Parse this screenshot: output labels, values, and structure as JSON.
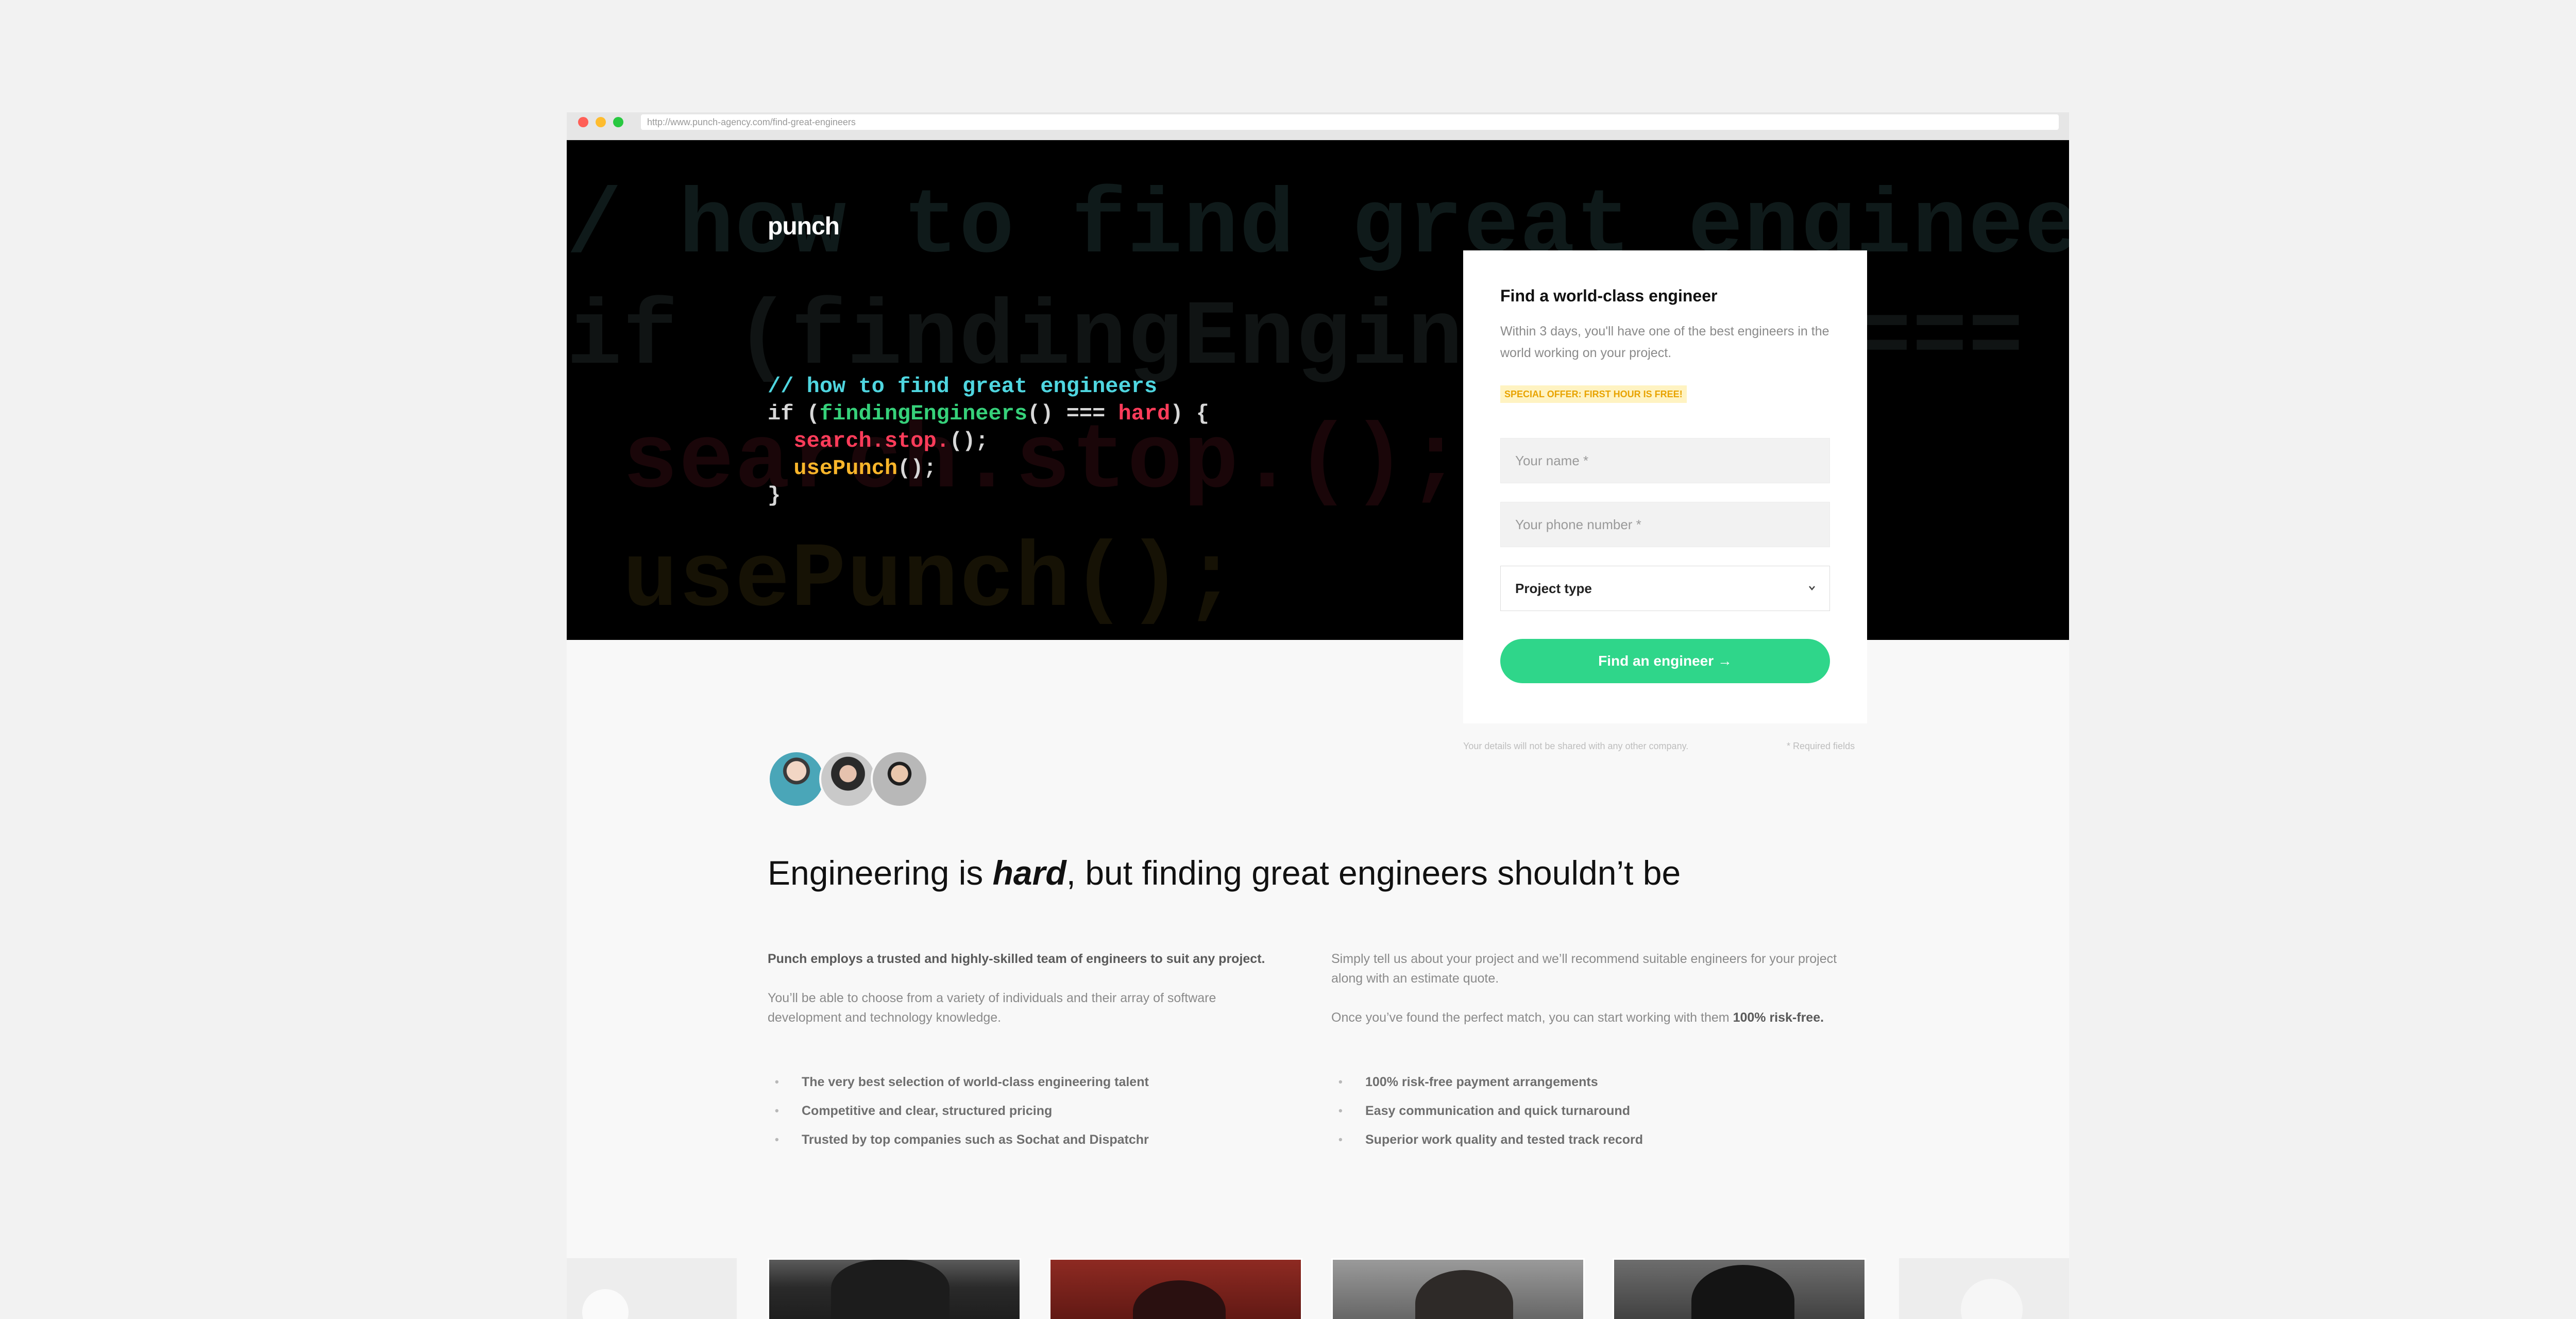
{
  "browser": {
    "url": "http://www.punch-agency.com/find-great-engineers"
  },
  "hero": {
    "logo": "punch",
    "background_code": [
      "/ how to find great engineers",
      "if (findingEngineers() ===",
      " search.stop.();",
      " usePunch();"
    ],
    "code": {
      "line1": "// how to find great engineers",
      "line2_if": "if (",
      "line2_fn": "findingEngineers",
      "line2_op": "() === ",
      "line2_kw": "hard",
      "line2_end": ") {",
      "line3_a": "search.stop.",
      "line3_b": "();",
      "line4_a": "usePunch",
      "line4_b": "();",
      "line5": "}"
    }
  },
  "form": {
    "title": "Find a world-class engineer",
    "description": "Within 3 days, you'll have one of the best engineers in the world working on your project.",
    "offer": "SPECIAL OFFER: FIRST HOUR IS FREE!",
    "name_placeholder": "Your name *",
    "phone_placeholder": "Your phone number *",
    "project_type": "Project type",
    "submit": "Find an engineer →",
    "privacy_note": "Your details will not be shared with any other company.",
    "required_note": "* Required fields"
  },
  "main": {
    "headline_start": "Engineering is ",
    "headline_em": "hard",
    "headline_end": ", but finding great engineers shouldn’t be",
    "left_intro": "Punch employs a trusted and highly-skilled team of engineers to suit any project.",
    "left_body": "You’ll be able to choose from a variety of individuals and their array of software development and technology knowledge.",
    "right_intro": "Simply tell us about your project and we’ll recommend suitable engineers for your project along with an estimate quote.",
    "right_body_start": "Once you’ve found the perfect match, you can start working with them ",
    "right_body_bold": "100% risk-free.",
    "left_bullets": [
      "The very best selection of world-class engineering talent",
      "Competitive and clear, structured pricing",
      "Trusted by top companies such as Sochat and Dispatchr"
    ],
    "right_bullets": [
      "100% risk-free payment arrangements",
      "Easy communication and quick turnaround",
      "Superior work quality and tested track record"
    ]
  },
  "colors": {
    "accent_green": "#2fd68a",
    "code_cyan": "#4fd6e0",
    "code_green": "#36d17a",
    "code_red": "#ff3c5a",
    "code_yellow": "#f8b52a",
    "offer_bg": "#fff3c2"
  }
}
